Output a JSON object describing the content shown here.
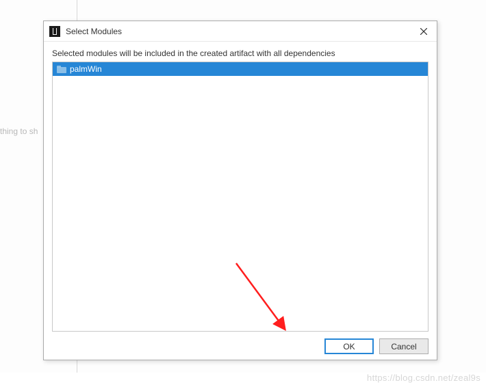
{
  "background": {
    "partial_text": "thing to sh"
  },
  "dialog": {
    "title": "Select Modules",
    "instruction": "Selected modules will be included in the created artifact with all dependencies",
    "list": {
      "items": [
        {
          "label": "palmWin",
          "selected": true
        }
      ]
    },
    "buttons": {
      "ok": "OK",
      "cancel": "Cancel"
    }
  },
  "watermark": "https://blog.csdn.net/zeal9s"
}
